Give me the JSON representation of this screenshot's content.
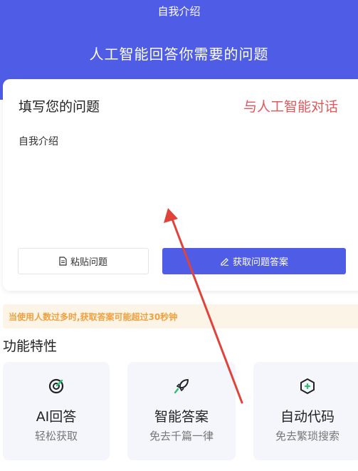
{
  "header": {
    "page_title": "自我介绍",
    "headline": "人工智能回答你需要的问题"
  },
  "question_card": {
    "title": "填写您的问题",
    "ai_chat_link": "与人工智能对话",
    "question_text": "自我介绍",
    "paste_button": "粘贴问题",
    "answer_button": "获取问题答案"
  },
  "notice": {
    "text": "当使用人数过多时,获取答案可能超过30秒钟"
  },
  "features": {
    "section_title": "功能特性",
    "items": [
      {
        "title": "AI回答",
        "subtitle": "轻松获取",
        "icon": "target-icon"
      },
      {
        "title": "智能答案",
        "subtitle": "免去千篇一律",
        "icon": "rocket-icon"
      },
      {
        "title": "自动代码",
        "subtitle": "免去繁琐搜索",
        "icon": "code-hexagon-icon"
      }
    ]
  },
  "colors": {
    "primary": "#4f5ce6",
    "accent_red": "#e2585b",
    "notice_orange": "#f0a13d",
    "icon_green": "#2fbf71",
    "arrow_red": "#e0433a"
  }
}
